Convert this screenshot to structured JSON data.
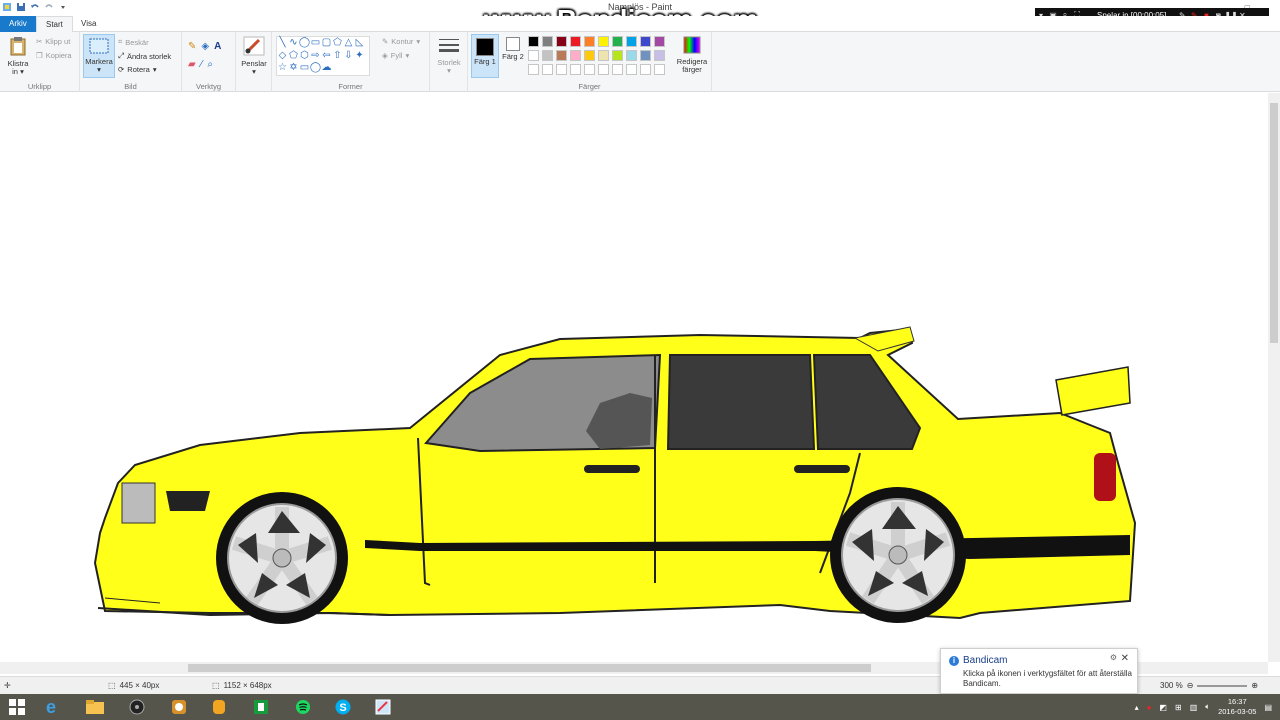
{
  "window": {
    "title": "Namnlös - Paint"
  },
  "watermark": {
    "text": "www.Bandicam.com"
  },
  "recorder": {
    "status": "Spelar in [00:00:05]"
  },
  "tabs": [
    {
      "label": "Arkiv"
    },
    {
      "label": "Start"
    },
    {
      "label": "Visa"
    }
  ],
  "ribbon": {
    "clipboard": {
      "paste_label": "Klistra in",
      "cut_label": "Klipp ut",
      "copy_label": "Kopiera",
      "group_label": "Urklipp"
    },
    "image": {
      "select_label": "Markera",
      "crop_label": "Beskär",
      "resize_label": "Ändra storlek",
      "rotate_label": "Rotera",
      "group_label": "Bild"
    },
    "tools": {
      "group_label": "Verktyg"
    },
    "brushes": {
      "label": "Penslar"
    },
    "shapes": {
      "outline_label": "Kontur",
      "fill_label": "Fyll",
      "group_label": "Former"
    },
    "size": {
      "label": "Storlek"
    },
    "colors": {
      "color1_label": "Färg 1",
      "color2_label": "Färg 2",
      "edit_label": "Redigera färger",
      "group_label": "Färger",
      "color1": "#000000",
      "color2": "#ffffff",
      "palette": [
        "#000000",
        "#7f7f7f",
        "#880015",
        "#ed1c24",
        "#ff7f27",
        "#fff200",
        "#22b14c",
        "#00a2e8",
        "#3f48cc",
        "#a349a4",
        "#ffffff",
        "#c3c3c3",
        "#b97a57",
        "#ffaec9",
        "#ffc90e",
        "#efe4b0",
        "#b5e61d",
        "#99d9ea",
        "#7092be",
        "#c8bfe7"
      ]
    }
  },
  "status": {
    "selection_size": "445 × 40px",
    "image_size": "1152 × 648px",
    "zoom": "300 %"
  },
  "toast": {
    "title": "Bandicam",
    "body": "Klicka på ikonen i verktygsfältet för att återställa Bandicam."
  },
  "taskbar": {
    "time": "16:37",
    "date": "2016-03-05"
  },
  "drawing": {
    "car_color": "#ffff1a",
    "window_color": "#3a3a3a"
  }
}
